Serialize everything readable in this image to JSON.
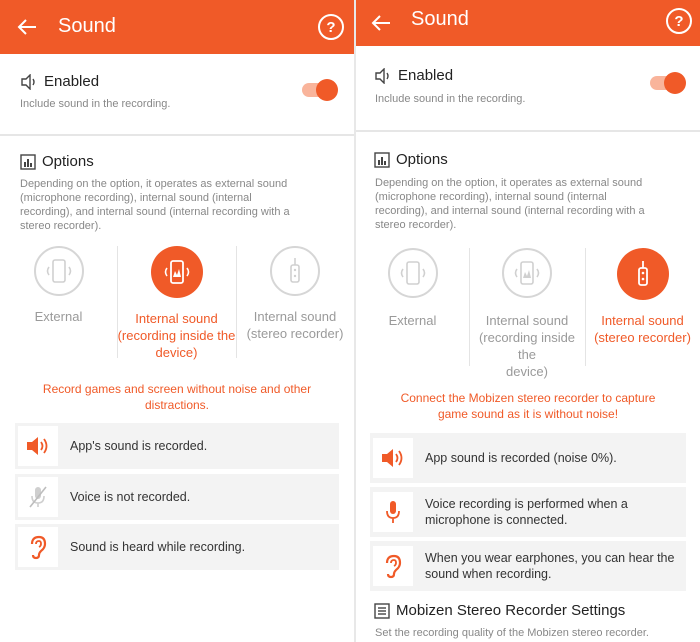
{
  "colors": {
    "accent": "#f05a28",
    "muted": "#9a9a9a",
    "row_bg": "#f3f3f3"
  },
  "left": {
    "title": "Sound",
    "help": "?",
    "enabled": {
      "label": "Enabled",
      "sub": "Include sound in the recording.",
      "on": true
    },
    "options": {
      "label": "Options",
      "desc_lines": [
        "Depending on the option, it operates as external sound",
        "(microphone recording), internal sound (internal",
        "recording), and internal sound (internal recording with a",
        "stereo recorder)."
      ]
    },
    "modes": [
      {
        "lines": [
          "External"
        ],
        "icon": "phone-sound-icon",
        "active": false
      },
      {
        "lines": [
          "Internal sound",
          "(recording inside the",
          "device)"
        ],
        "icon": "phone-sound-icon",
        "active": true
      },
      {
        "lines": [
          "Internal sound",
          "(stereo recorder)"
        ],
        "icon": "stereo-recorder-icon",
        "active": false
      }
    ],
    "promo_lines": [
      "Record games and screen without noise and other",
      "distractions."
    ],
    "features": [
      {
        "icon": "speaker-icon",
        "lines": [
          "App's sound is recorded."
        ]
      },
      {
        "icon": "mic-off-icon",
        "lines": [
          "Voice is not recorded."
        ]
      },
      {
        "icon": "ear-icon",
        "lines": [
          "Sound is heard while recording."
        ]
      }
    ]
  },
  "right": {
    "title": "Sound",
    "help": "?",
    "enabled": {
      "label": "Enabled",
      "sub": "Include sound in the recording.",
      "on": true
    },
    "options": {
      "label": "Options",
      "desc_lines": [
        "Depending on the option, it operates as external sound",
        "(microphone recording), internal sound (internal",
        "recording), and internal sound (internal recording with a",
        "stereo recorder)."
      ]
    },
    "modes": [
      {
        "lines": [
          "External"
        ],
        "icon": "phone-sound-icon",
        "active": false
      },
      {
        "lines": [
          "Internal sound",
          "(recording inside the",
          "device)"
        ],
        "icon": "phone-sound-icon",
        "active": false
      },
      {
        "lines": [
          "Internal sound",
          "(stereo recorder)"
        ],
        "icon": "stereo-recorder-icon",
        "active": true
      }
    ],
    "promo_lines": [
      "Connect the Mobizen stereo recorder to capture",
      "game sound as it is without noise!"
    ],
    "features": [
      {
        "icon": "speaker-icon",
        "lines": [
          "App sound is recorded (noise 0%)."
        ]
      },
      {
        "icon": "mic-icon",
        "lines": [
          "Voice recording is performed when a",
          "microphone is connected."
        ]
      },
      {
        "icon": "ear-icon",
        "lines": [
          "When you wear earphones, you can hear the",
          "sound when recording."
        ]
      }
    ],
    "settings": {
      "label": "Mobizen Stereo Recorder Settings",
      "sub": "Set the recording quality of the Mobizen stereo recorder."
    }
  }
}
